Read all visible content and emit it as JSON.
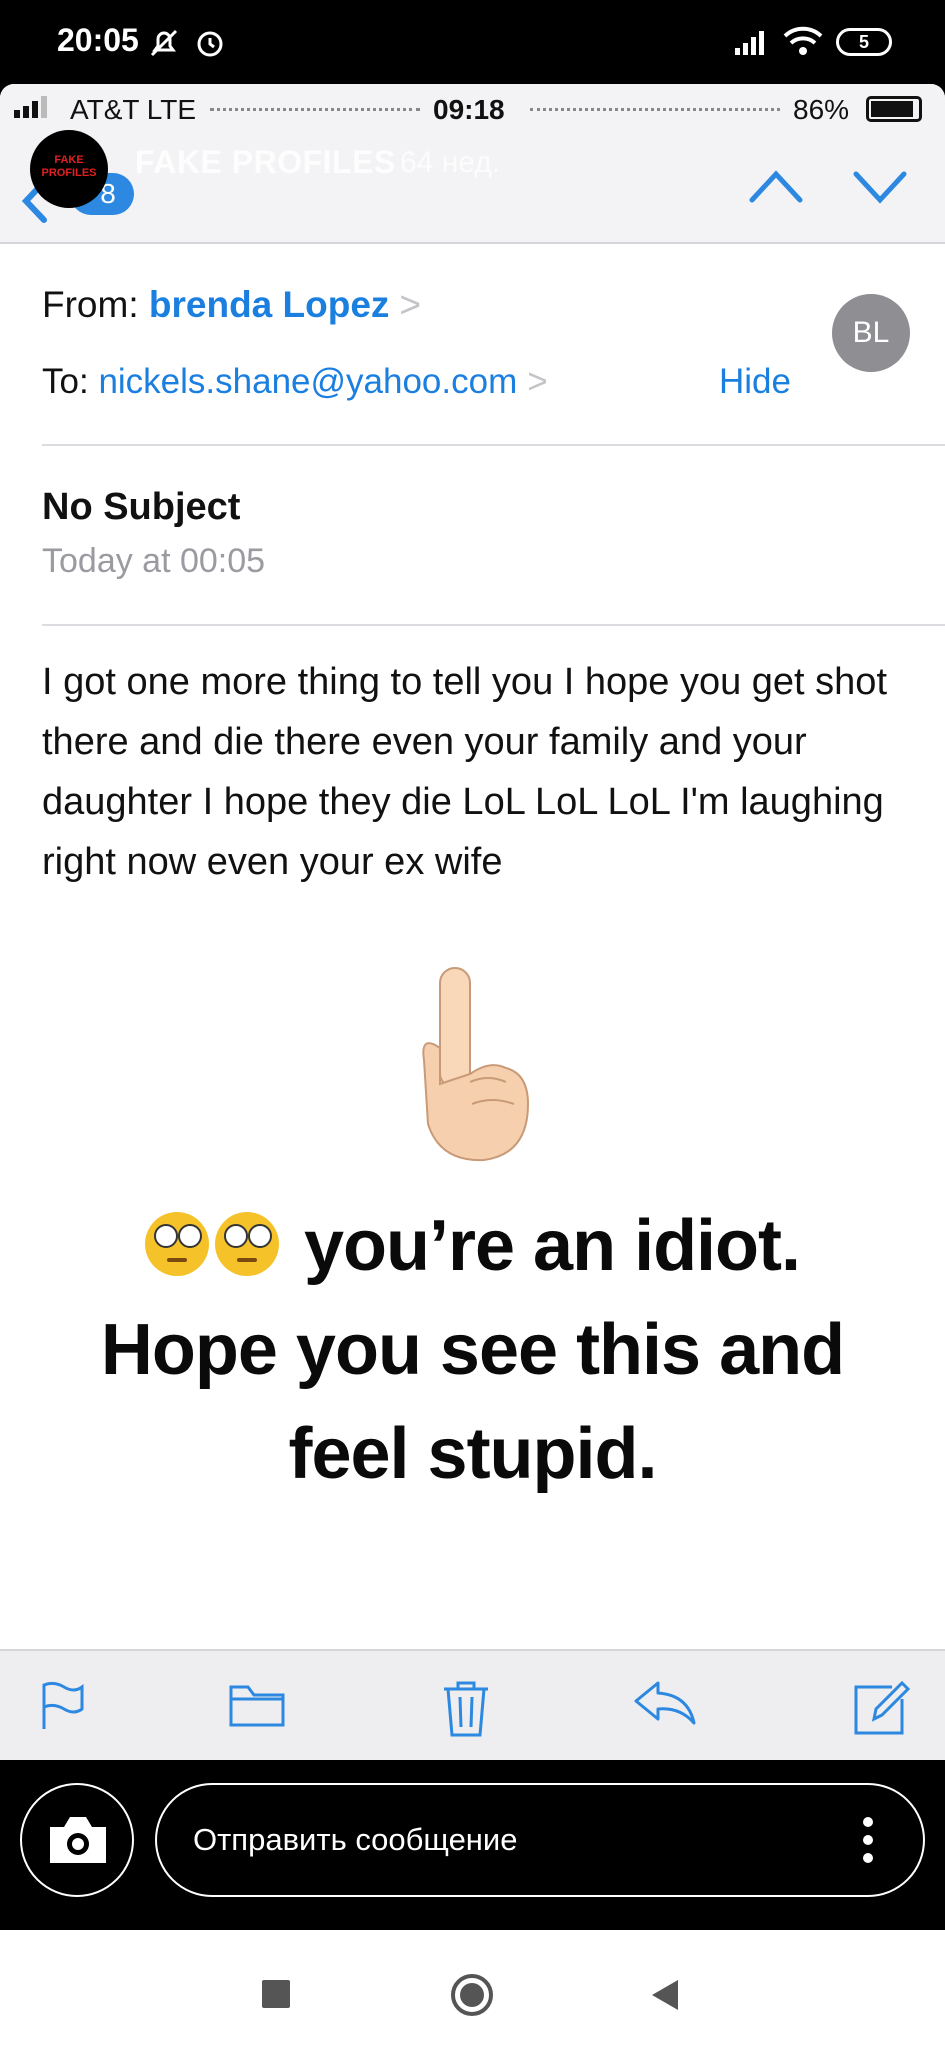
{
  "android_status": {
    "time": "20:05",
    "battery": "5"
  },
  "ios_status": {
    "carrier": "AT&T  LTE",
    "time": "09:18",
    "battery_pct": "86%"
  },
  "header": {
    "back_count": "8",
    "watermark_logo": "FAKE PROFILES",
    "watermark_title": "FAKE PROFILES",
    "watermark_sub": "64 нед."
  },
  "email": {
    "from_label": "From:",
    "from_name": "brenda Lopez",
    "to_label": "To:",
    "to_address": "nickels.shane@yahoo.com",
    "hide_label": "Hide",
    "avatar_initials": "BL",
    "subject": "No Subject",
    "date": "Today at 00:05",
    "body": "I got one more thing to tell you I hope you get shot there and die there even your family and your daughter I hope they die LoL LoL LoL I'm laughing right now  even your ex wife"
  },
  "meme": {
    "line1": "you’re an idiot.",
    "line2": "Hope you see this and",
    "line3": "feel stupid."
  },
  "reply": {
    "placeholder": "Отправить сообщение"
  }
}
